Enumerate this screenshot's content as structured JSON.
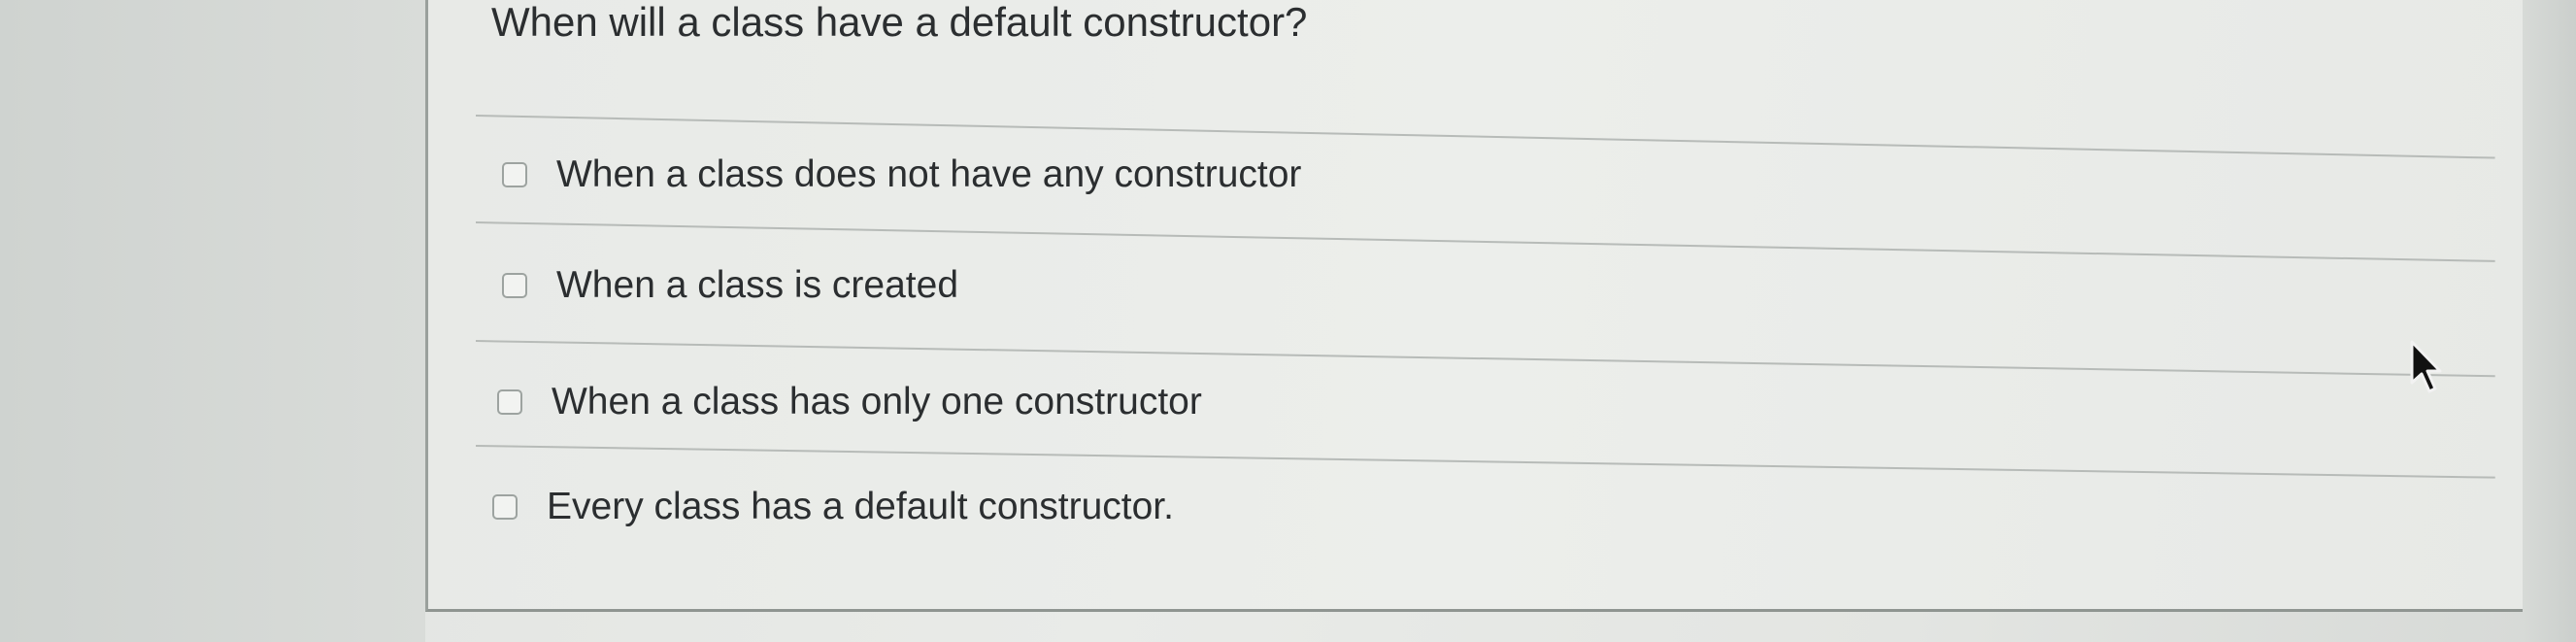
{
  "question": {
    "text": "When will a class have a default constructor?"
  },
  "options": [
    {
      "label": "When a class does not have any constructor",
      "checked": false
    },
    {
      "label": "When a class is created",
      "checked": false
    },
    {
      "label": "When a class has only one constructor",
      "checked": false
    },
    {
      "label": "Every class has a default constructor.",
      "checked": false
    }
  ],
  "pointer": {
    "icon": "mouse-pointer-icon"
  },
  "colors": {
    "text": "#2b2e30",
    "divider": "#b7bbb8",
    "checkbox_border": "#9da3a0",
    "background": "#e9ebe8"
  }
}
